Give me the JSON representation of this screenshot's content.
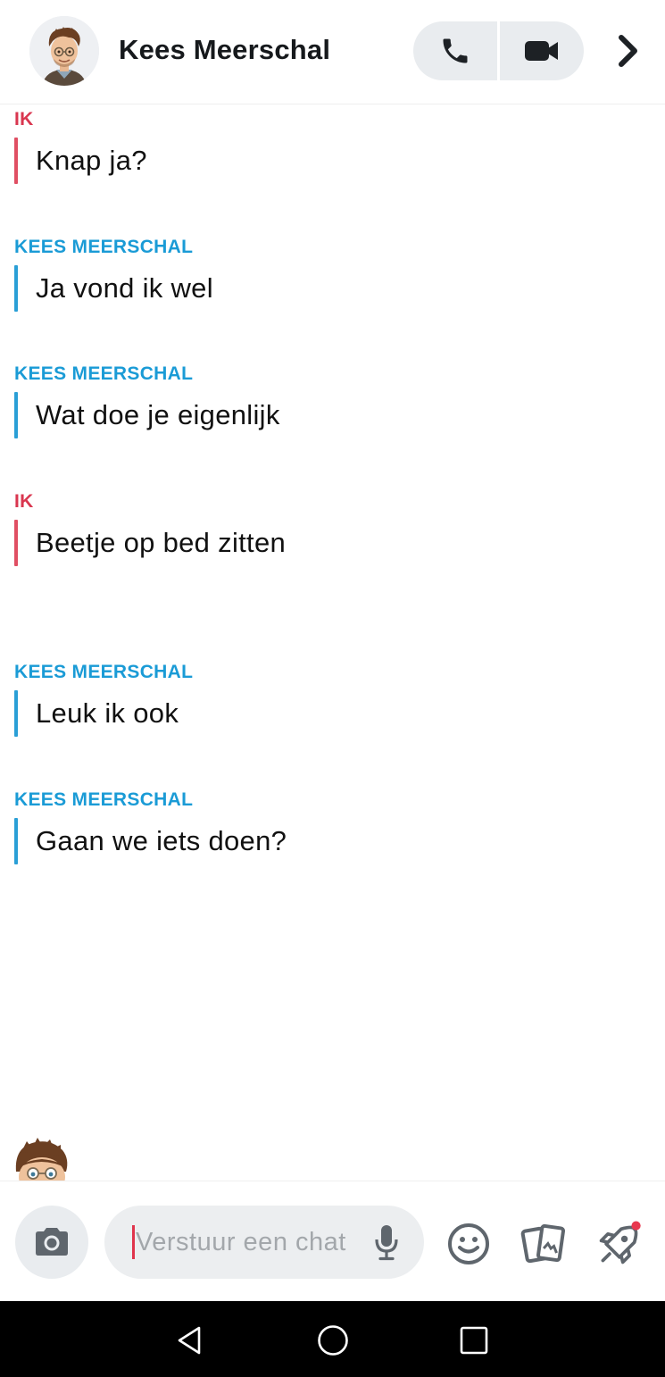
{
  "header": {
    "contact_name": "Kees Meerschal",
    "icons": [
      "avatar-bitmoji",
      "phone-icon",
      "video-camera-icon",
      "chevron-right-icon"
    ]
  },
  "messages": [
    {
      "sender": "IK",
      "text": "Knap ja?",
      "from": "me"
    },
    {
      "sender": "KEES MEERSCHAL",
      "text": "Ja vond ik wel",
      "from": "them"
    },
    {
      "sender": "KEES MEERSCHAL",
      "text": "Wat doe je eigenlijk",
      "from": "them"
    },
    {
      "sender": "IK",
      "text": "Beetje op bed zitten",
      "from": "me"
    },
    {
      "sender": "KEES MEERSCHAL",
      "text": "Leuk ik ook",
      "from": "them"
    },
    {
      "sender": "KEES MEERSCHAL",
      "text": "Gaan we iets doen?",
      "from": "them"
    }
  ],
  "compose": {
    "placeholder": "Verstuur een chat",
    "icons": [
      "camera-icon",
      "microphone-icon",
      "smiley-icon",
      "cards-icon",
      "rocket-icon"
    ]
  },
  "colors": {
    "me": "#e04f63",
    "them": "#2a9fd6",
    "notification_dot": "#e8384f"
  }
}
